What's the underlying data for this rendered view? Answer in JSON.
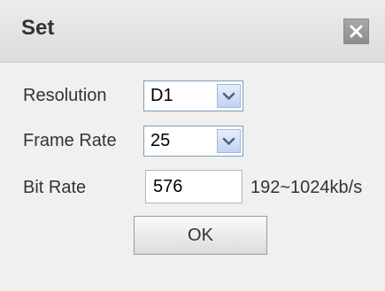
{
  "dialog": {
    "title": "Set",
    "close_icon": "close-icon"
  },
  "form": {
    "resolution": {
      "label": "Resolution",
      "value": "D1",
      "icon": "chevron-down-icon"
    },
    "frame_rate": {
      "label": "Frame Rate",
      "value": "25",
      "icon": "chevron-down-icon"
    },
    "bit_rate": {
      "label": "Bit Rate",
      "value": "576",
      "range_hint": "192~1024kb/s"
    }
  },
  "actions": {
    "ok_label": "OK"
  },
  "colors": {
    "title_bar": "#e4e4e4",
    "body": "#f0f0f0",
    "close_button": "#999999",
    "dropdown_button": "#c8d8f8"
  }
}
